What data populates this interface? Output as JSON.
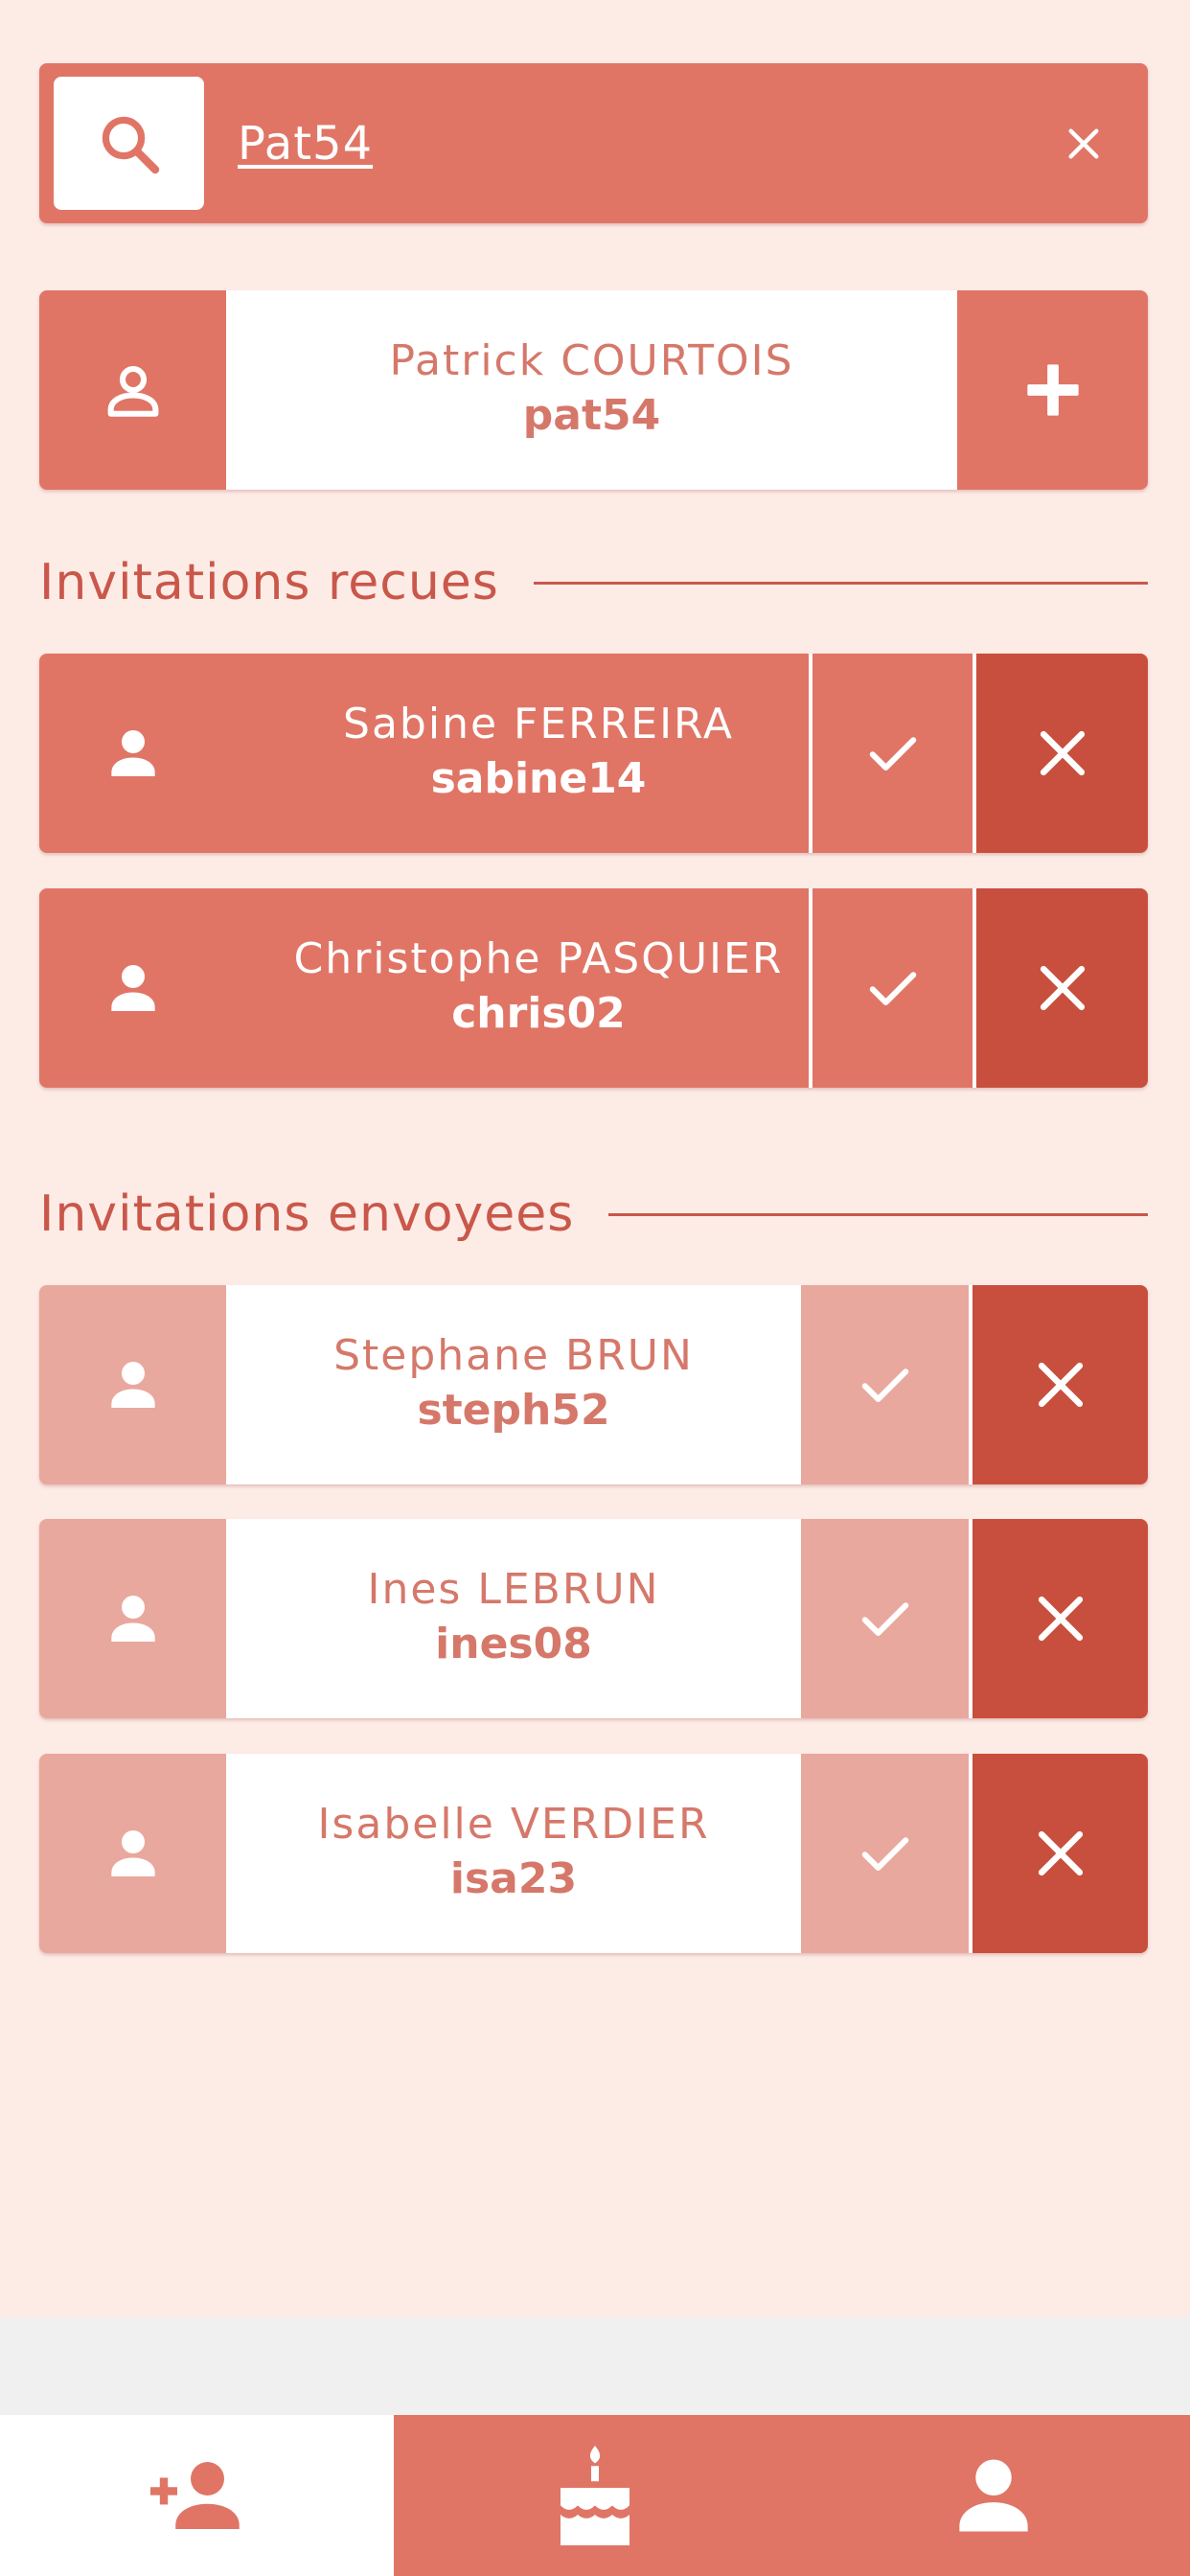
{
  "search": {
    "query": "Pat54",
    "icon": "search-icon",
    "clear_icon": "close-icon"
  },
  "result": {
    "name": "Patrick COURTOIS",
    "username": "pat54",
    "icon": "user-outline-icon",
    "action_icon": "plus-icon"
  },
  "received": {
    "title": "Invitations recues",
    "items": [
      {
        "name": "Sabine FERREIRA",
        "username": "sabine14"
      },
      {
        "name": "Christophe PASQUIER",
        "username": "chris02"
      }
    ]
  },
  "sent": {
    "title": "Invitations envoyees",
    "items": [
      {
        "name": "Stephane BRUN",
        "username": "steph52"
      },
      {
        "name": "Ines LEBRUN",
        "username": "ines08"
      },
      {
        "name": "Isabelle VERDIER",
        "username": "isa23"
      }
    ]
  },
  "nav": {
    "tabs": [
      {
        "icon": "add-friend-icon",
        "active": true
      },
      {
        "icon": "birthday-cake-icon",
        "active": false
      },
      {
        "icon": "profile-icon",
        "active": false
      }
    ]
  },
  "colors": {
    "background": "#fdebe6",
    "primary": "#e07566",
    "primary_light": "#e9a89d",
    "danger": "#c84f3d",
    "text_accent": "#d5786a"
  }
}
